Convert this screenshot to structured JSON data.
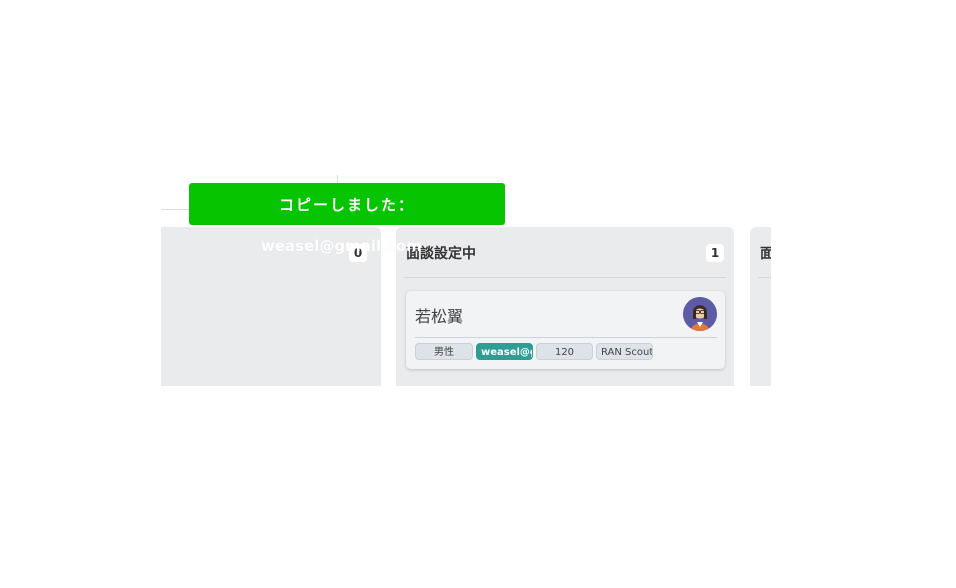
{
  "toast": {
    "title": "コピーしました：",
    "value": "weasel@gmail.com"
  },
  "columns": [
    {
      "title": "",
      "count": "0"
    },
    {
      "title": "面談設定中",
      "count": "1"
    },
    {
      "title": "面",
      "count": ""
    }
  ],
  "card": {
    "name": "若松翼",
    "avatar_icon": "person-avatar-icon",
    "tags": {
      "gender": "男性",
      "email": "weasel@gmail.com",
      "number": "120",
      "source": "RAN Scout"
    }
  },
  "colors": {
    "toast_bg": "#07c400",
    "email_tag_bg": "#2d9d96",
    "column_bg": "#eaebed"
  }
}
